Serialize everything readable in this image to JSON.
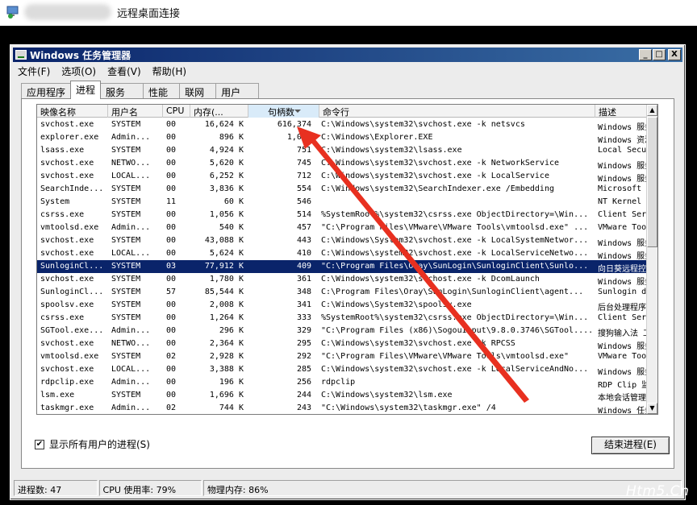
{
  "rdp": {
    "title": "远程桌面连接"
  },
  "window": {
    "title": "Windows 任务管理器",
    "btn_min": "_",
    "btn_max": "□",
    "btn_close": "X"
  },
  "menu": [
    "文件(F)",
    "选项(O)",
    "查看(V)",
    "帮助(H)"
  ],
  "tabs": [
    "应用程序",
    "进程",
    "服务",
    "性能",
    "联网",
    "用户"
  ],
  "active_tab": 1,
  "columns": [
    "映像名称",
    "用户名",
    "CPU",
    "内存(...",
    "句柄数",
    "命令行",
    "描述"
  ],
  "rows": [
    [
      "svchost.exe",
      "SYSTEM",
      "00",
      "16,624 K",
      "616,374",
      "C:\\Windows\\system32\\svchost.exe -k netsvcs",
      "Windows 服务"
    ],
    [
      "explorer.exe",
      "Admin...",
      "00",
      "896 K",
      "1,098",
      "C:\\Windows\\Explorer.EXE",
      "Windows 资源"
    ],
    [
      "lsass.exe",
      "SYSTEM",
      "00",
      "4,924 K",
      "751",
      "C:\\Windows\\system32\\lsass.exe",
      "Local Securi"
    ],
    [
      "svchost.exe",
      "NETWO...",
      "00",
      "5,620 K",
      "745",
      "C:\\Windows\\system32\\svchost.exe -k NetworkService",
      "Windows 服务"
    ],
    [
      "svchost.exe",
      "LOCAL...",
      "00",
      "6,252 K",
      "712",
      "C:\\Windows\\system32\\svchost.exe -k LocalService",
      "Windows 服务"
    ],
    [
      "SearchInde...",
      "SYSTEM",
      "00",
      "3,836 K",
      "554",
      "C:\\Windows\\system32\\SearchIndexer.exe /Embedding",
      "Microsoft Wi"
    ],
    [
      "System",
      "SYSTEM",
      "11",
      "60 K",
      "546",
      "",
      "NT Kernel &"
    ],
    [
      "csrss.exe",
      "SYSTEM",
      "00",
      "1,056 K",
      "514",
      "%SystemRoot%\\system32\\csrss.exe ObjectDirectory=\\Win...",
      "Client Serve"
    ],
    [
      "vmtoolsd.exe",
      "Admin...",
      "00",
      "540 K",
      "457",
      "\"C:\\Program Files\\VMware\\VMware Tools\\vmtoolsd.exe\" ...",
      "VMware Tools"
    ],
    [
      "svchost.exe",
      "SYSTEM",
      "00",
      "43,088 K",
      "443",
      "C:\\Windows\\System32\\svchost.exe -k LocalSystemNetwor...",
      "Windows 服务"
    ],
    [
      "svchost.exe",
      "LOCAL...",
      "00",
      "5,624 K",
      "410",
      "C:\\Windows\\system32\\svchost.exe -k LocalServiceNetwo...",
      "Windows 服务"
    ],
    [
      "SunloginCl...",
      "SYSTEM",
      "03",
      "77,912 K",
      "409",
      "\"C:\\Program Files\\Oray\\SunLogin\\SunloginClient\\Sunlo...",
      "向日葵远程控"
    ],
    [
      "svchost.exe",
      "SYSTEM",
      "00",
      "1,780 K",
      "361",
      "C:\\Windows\\system32\\svchost.exe -k DcomLaunch",
      "Windows 服务"
    ],
    [
      "SunloginCl...",
      "SYSTEM",
      "57",
      "85,544 K",
      "348",
      "C:\\Program Files\\Oray\\SunLogin\\SunloginClient\\agent...",
      "Sunlogin des"
    ],
    [
      "spoolsv.exe",
      "SYSTEM",
      "00",
      "2,008 K",
      "341",
      "C:\\Windows\\System32\\spoolsv.exe",
      "后台处理程序"
    ],
    [
      "csrss.exe",
      "SYSTEM",
      "00",
      "1,264 K",
      "333",
      "%SystemRoot%\\system32\\csrss.exe ObjectDirectory=\\Win...",
      "Client Serve"
    ],
    [
      "SGTool.exe...",
      "Admin...",
      "00",
      "296 K",
      "329",
      "\"C:\\Program Files (x86)\\SogouInput\\9.8.0.3746\\SGTool....",
      "搜狗输入法 工"
    ],
    [
      "svchost.exe",
      "NETWO...",
      "00",
      "2,364 K",
      "295",
      "C:\\Windows\\system32\\svchost.exe -k RPCSS",
      "Windows 服务"
    ],
    [
      "vmtoolsd.exe",
      "SYSTEM",
      "02",
      "2,928 K",
      "292",
      "\"C:\\Program Files\\VMware\\VMware Tools\\vmtoolsd.exe\"",
      "VMware Tools"
    ],
    [
      "svchost.exe",
      "LOCAL...",
      "00",
      "3,388 K",
      "285",
      "C:\\Windows\\system32\\svchost.exe -k LocalServiceAndNo...",
      "Windows 服务"
    ],
    [
      "rdpclip.exe",
      "Admin...",
      "00",
      "196 K",
      "256",
      "rdpclip",
      "RDP Clip 监视"
    ],
    [
      "lsm.exe",
      "SYSTEM",
      "00",
      "1,696 K",
      "244",
      "C:\\Windows\\system32\\lsm.exe",
      "本地会话管理"
    ],
    [
      "taskmgr.exe",
      "Admin...",
      "02",
      "744 K",
      "243",
      "\"C:\\Windows\\system32\\taskmgr.exe\" /4",
      "Windows 任务"
    ]
  ],
  "selected_row": 11,
  "show_all_label": "显示所有用户的进程(S)",
  "show_all_checked": "✔",
  "end_process": "结束进程(E)",
  "status": {
    "processes": "进程数: 47",
    "cpu": "CPU 使用率: 79%",
    "memory": "物理内存: 86%"
  },
  "watermark": "Htm5.Cn",
  "colors": {
    "titlebar": "#0a246a",
    "selection": "#0a246a",
    "arrow": "#e83020"
  }
}
